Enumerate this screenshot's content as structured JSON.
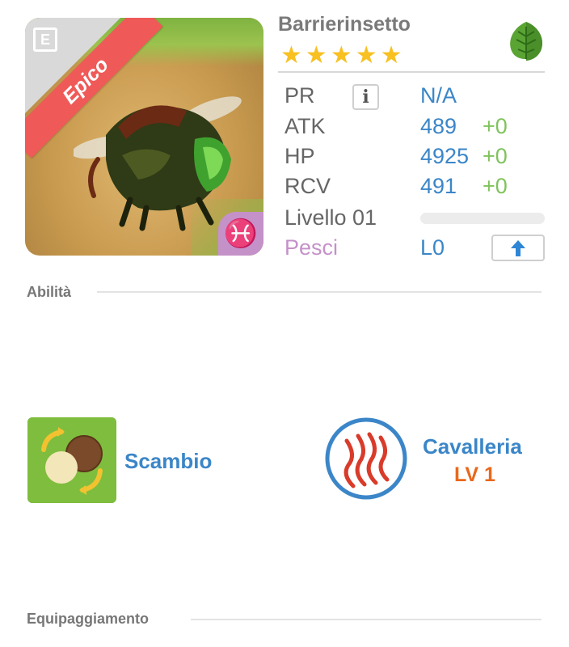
{
  "monster": {
    "name": "Barrierinsetto",
    "rarity": "Epico",
    "stars": 5,
    "element": "leaf-icon",
    "zodiac_symbol": "♓"
  },
  "stats": {
    "pr": {
      "label": "PR",
      "value": "N/A"
    },
    "atk": {
      "label": "ATK",
      "value": "489",
      "bonus": "+0"
    },
    "hp": {
      "label": "HP",
      "value": "4925",
      "bonus": "+0"
    },
    "rcv": {
      "label": "RCV",
      "value": "491",
      "bonus": "+0"
    },
    "level": {
      "label": "Livello 01",
      "progress": 0
    },
    "zodiac": {
      "label": "Pesci",
      "value": "L0"
    }
  },
  "sections": {
    "abilities": "Abilità",
    "equipment": "Equipaggiamento"
  },
  "abilities": [
    {
      "name": "Scambio"
    },
    {
      "name": "Cavalleria",
      "level": "LV 1"
    }
  ],
  "colors": {
    "accent_blue": "#3b86c8",
    "bonus_green": "#7fc35b",
    "rarity_red": "#ef5a58",
    "zodiac_purple": "#c591c9",
    "star_gold": "#f8c021",
    "level_orange": "#e8681c"
  }
}
